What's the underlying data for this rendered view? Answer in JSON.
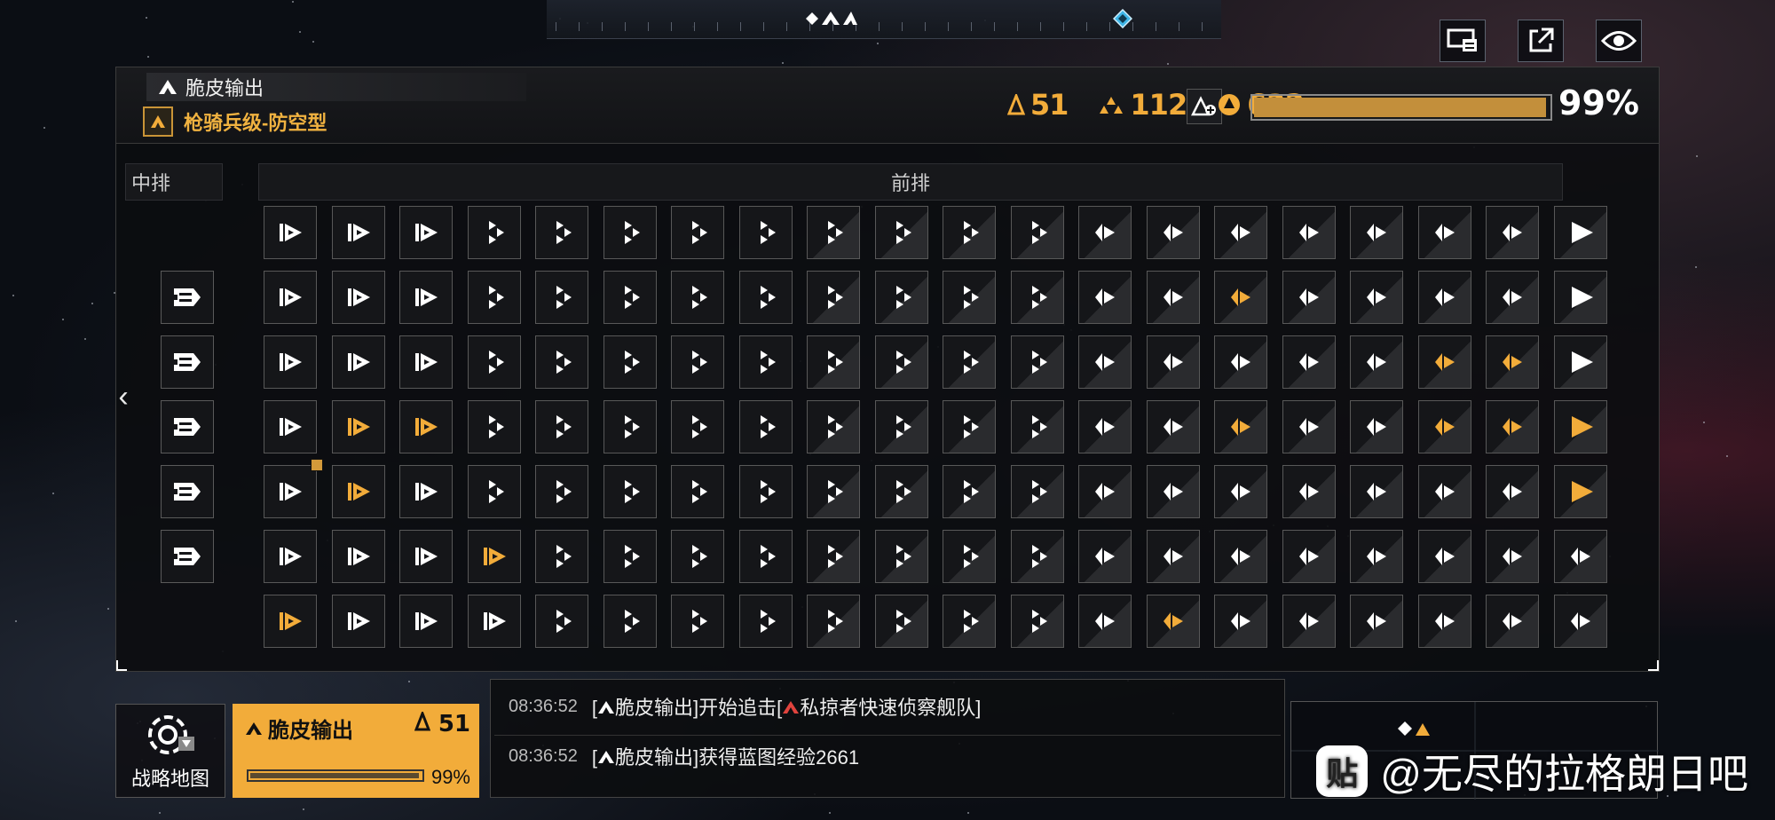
{
  "fleet": {
    "name": "脆皮输出",
    "ship_class": "枪骑兵级-防空型",
    "level": "51"
  },
  "stats": {
    "level": "51",
    "stat2": "112",
    "stat3": "632",
    "progress_pct": 99,
    "progress_label": "99%"
  },
  "columns": {
    "middle": "中排",
    "front": "前排"
  },
  "icons": {
    "map_icon": "target-icon",
    "top_buttons": [
      "screen-icon",
      "share-icon",
      "eye-icon"
    ]
  },
  "grid": {
    "rows": [
      [
        "a",
        "a",
        "a",
        "b",
        "b",
        "b",
        "b",
        "b",
        "b",
        "b",
        "b",
        "b",
        "c",
        "c",
        "c",
        "c",
        "c",
        "c",
        "c",
        "d"
      ],
      [
        "a",
        "a",
        "a",
        "b",
        "b",
        "b",
        "b",
        "b",
        "b",
        "b",
        "b",
        "b",
        "c",
        "c",
        "C",
        "c",
        "c",
        "c",
        "c",
        "d"
      ],
      [
        "a",
        "a",
        "a",
        "b",
        "b",
        "b",
        "b",
        "b",
        "b",
        "b",
        "b",
        "b",
        "c",
        "c",
        "c",
        "c",
        "c",
        "C",
        "C",
        "d"
      ],
      [
        "a",
        "A",
        "A",
        "b",
        "b",
        "b",
        "b",
        "b",
        "b",
        "b",
        "b",
        "b",
        "c",
        "c",
        "C",
        "c",
        "c",
        "C",
        "C",
        "D"
      ],
      [
        "a",
        "A",
        "a",
        "b",
        "b",
        "b",
        "b",
        "b",
        "b",
        "b",
        "b",
        "b",
        "c",
        "c",
        "c",
        "c",
        "c",
        "c",
        "c",
        "D"
      ],
      [
        "a",
        "a",
        "a",
        "A",
        "b",
        "b",
        "b",
        "b",
        "b",
        "b",
        "b",
        "b",
        "c",
        "c",
        "c",
        "c",
        "c",
        "c",
        "c",
        "c"
      ],
      [
        "A",
        "a",
        "a",
        "a",
        "b",
        "b",
        "b",
        "b",
        "b",
        "b",
        "b",
        "b",
        "c",
        "C",
        "c",
        "c",
        "c",
        "c",
        "c",
        "c"
      ]
    ],
    "middle_rows": [
      1,
      2,
      3,
      4,
      5
    ]
  },
  "bottom": {
    "map_label": "战略地图",
    "card_name": "脆皮输出",
    "card_level": "51",
    "card_pct": "99%",
    "card_progress": 99
  },
  "log": [
    {
      "time": "08:36:52",
      "pre": "[",
      "fleet": "脆皮输出",
      "mid": "]开始追击[",
      "target": "私掠者快速侦察舰队",
      "post": "]"
    },
    {
      "time": "08:36:52",
      "pre": "[",
      "fleet": "脆皮输出",
      "mid": "]获得蓝图经验2661",
      "target": "",
      "post": ""
    }
  ],
  "watermark": {
    "logo": "贴",
    "text": "@无尽的拉格朗日吧"
  },
  "colors": {
    "accent": "#f2ac3a",
    "white_icon": "#ffffff",
    "panel_bg": "#0c0d10"
  }
}
